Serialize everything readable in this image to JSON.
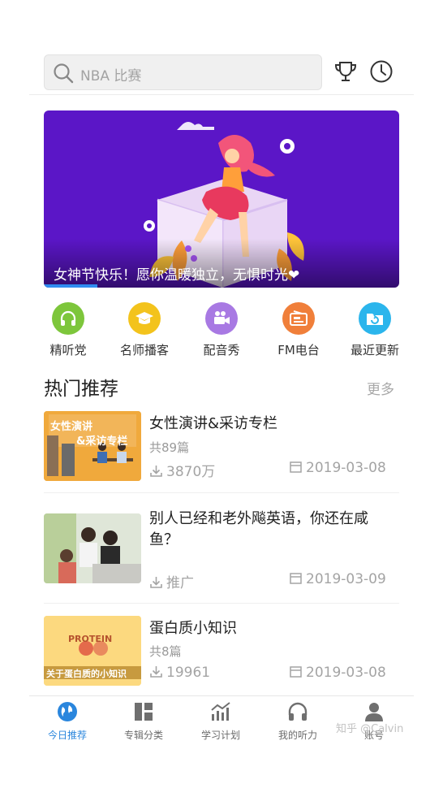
{
  "search": {
    "placeholder": "NBA 比赛"
  },
  "header_icons": [
    "trophy-icon",
    "clock-icon"
  ],
  "banner": {
    "caption": "女神节快乐！愿你温暖独立，无惧时光❤"
  },
  "categories": [
    {
      "label": "精听党",
      "icon": "headphones-icon",
      "color": "#7dc63b"
    },
    {
      "label": "名师播客",
      "icon": "graduation-cap-icon",
      "color": "#f3c31c"
    },
    {
      "label": "配音秀",
      "icon": "video-camera-icon",
      "color": "#a879e3"
    },
    {
      "label": "FM电台",
      "icon": "radio-icon",
      "color": "#f07f3a"
    },
    {
      "label": "最近更新",
      "icon": "refresh-folder-icon",
      "color": "#2bb5ec"
    }
  ],
  "section": {
    "title": "热门推荐",
    "more": "更多"
  },
  "items": [
    {
      "title": "女性演讲&采访专栏",
      "count": "共89篇",
      "downloads": "3870万",
      "date": "2019-03-08",
      "thumb_text_1": "女性演讲",
      "thumb_text_2": "&采访专栏"
    },
    {
      "title": "别人已经和老外飚英语，你还在咸鱼？",
      "tag": "推广",
      "date": "2019-03-09"
    },
    {
      "title": "蛋白质小知识",
      "count": "共8篇",
      "downloads": "19961",
      "date": "2019-03-08",
      "thumb_text_1": "PROTEIN",
      "thumb_text_2": "关于蛋白质的小知识"
    }
  ],
  "nav": [
    {
      "label": "今日推荐",
      "icon": "globe-icon",
      "active": true
    },
    {
      "label": "专辑分类",
      "icon": "category-grid-icon"
    },
    {
      "label": "学习计划",
      "icon": "bar-chart-trend-icon"
    },
    {
      "label": "我的听力",
      "icon": "headphones-icon"
    },
    {
      "label": "账号",
      "icon": "user-icon"
    }
  ],
  "watermark": "知乎 @Calvin",
  "colors": {
    "accent": "#2a86dd",
    "banner_bg": "#5b16c7"
  }
}
